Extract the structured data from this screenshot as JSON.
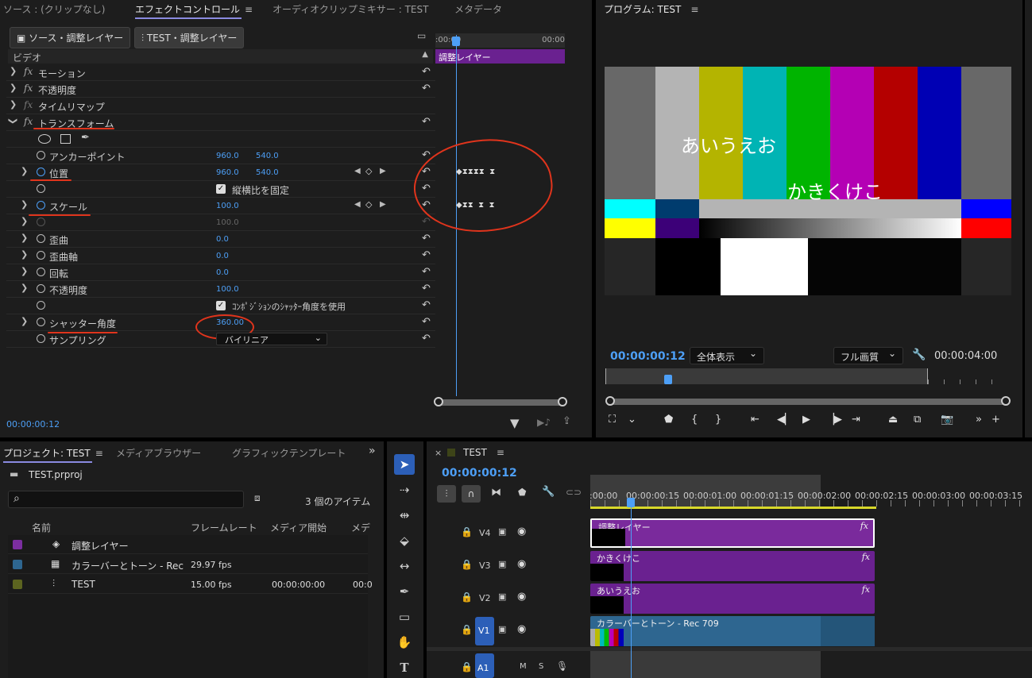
{
  "top_left_tabs": {
    "source": "ソース : (クリップなし)",
    "effect_controls": "エフェクトコントロール",
    "audio_mixer": "オーディオクリップミキサー : TEST",
    "metadata": "メタデータ"
  },
  "effect_controls": {
    "source_btn": "ソース・調整レイヤー",
    "seq_btn": "TEST・調整レイヤー",
    "section": "ビデオ",
    "timeline_clip": "調整レイヤー",
    "ruler_start": ":00:00",
    "ruler_end": "00:00",
    "rows": {
      "motion": "モーション",
      "opacity": "不透明度",
      "time_remap": "タイムリマップ",
      "transform": "トランスフォーム",
      "anchor": "アンカーポイント",
      "anchor_x": "960.0",
      "anchor_y": "540.0",
      "position": "位置",
      "position_x": "960.0",
      "position_y": "540.0",
      "uniform": "縦横比を固定",
      "scale": "スケール",
      "scale_val": "100.0",
      "scale_w_val": "100.0",
      "skew": "歪曲",
      "skew_val": "0.0",
      "skew_axis": "歪曲軸",
      "skew_axis_val": "0.0",
      "rotation": "回転",
      "rotation_val": "0.0",
      "opacity2": "不透明度",
      "opacity2_val": "100.0",
      "comp_shutter": "ｺﾝﾎﾟｼﾞｼｮﾝのｼｬｯﾀｰ角度を使用",
      "shutter": "シャッター角度",
      "shutter_val": "360.00",
      "sampling": "サンプリング",
      "sampling_val": "バイリニア"
    },
    "timecode": "00:00:00:12"
  },
  "program": {
    "title": "プログラム: TEST",
    "text1": "あいうえお",
    "text2": "かきくけこ",
    "timecode": "00:00:00:12",
    "fit": "全体表示",
    "quality": "フル画質",
    "duration": "00:00:04:00"
  },
  "project": {
    "tab_project": "プロジェクト: TEST",
    "tab_media": "メディアブラウザー",
    "tab_graphic": "グラフィックテンプレート",
    "file": "TEST.prproj",
    "item_count": "3 個のアイテム",
    "col_name": "名前",
    "col_fps": "フレームレート",
    "col_start": "メディア開始",
    "col_more": "メデ",
    "items": [
      {
        "name": "調整レイヤー",
        "fps": "",
        "start": "",
        "more": "",
        "color": "#7b2ea0"
      },
      {
        "name": "カラーバーとトーン - Rec",
        "fps": "29.97 fps",
        "start": "",
        "more": "",
        "color": "#2e6690"
      },
      {
        "name": "TEST",
        "fps": "15.00 fps",
        "start": "00:00:00:00",
        "more": "00:0",
        "color": "#5c6420"
      }
    ]
  },
  "timeline": {
    "title": "TEST",
    "timecode": "00:00:00:12",
    "ruler": [
      ":00:00",
      "00:00:00:15",
      "00:00:01:00",
      "00:00:01:15",
      "00:00:02:00",
      "00:00:02:15",
      "00:00:03:00",
      "00:00:03:15"
    ],
    "tracks": {
      "v4": "V4",
      "v3": "V3",
      "v2": "V2",
      "v1": "V1",
      "a1": "A1",
      "m": "M",
      "s": "S"
    },
    "clips": {
      "v4": "調整レイヤー",
      "v3": "かきくけこ",
      "v2": "あいうえお",
      "v1": "カラーバーとトーン - Rec 709"
    }
  }
}
